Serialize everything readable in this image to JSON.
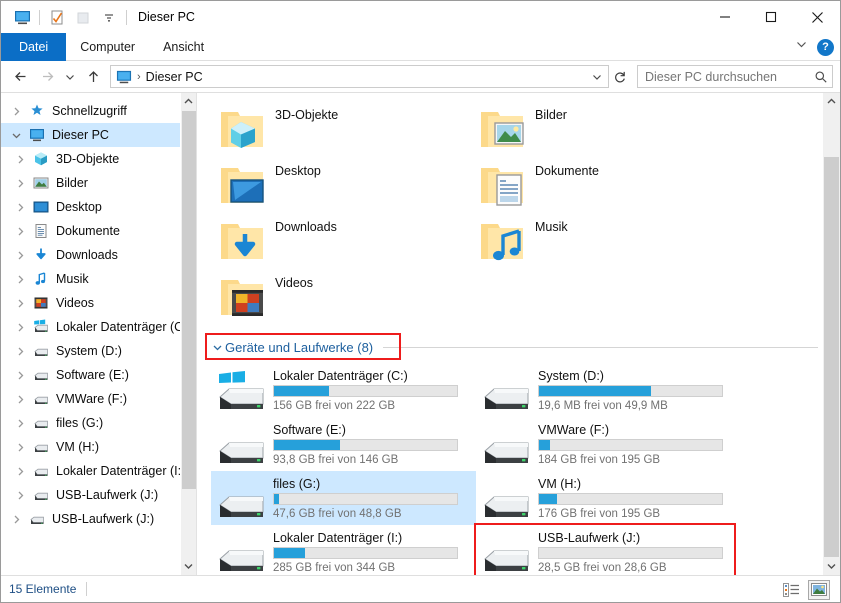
{
  "window": {
    "title": "Dieser PC",
    "quick_access": [
      "this-pc-icon",
      "properties-icon",
      "new-folder-icon",
      "customize-dropdown-icon"
    ],
    "controls": {
      "minimize": "—",
      "maximize": "□",
      "close": "✕"
    }
  },
  "ribbon": {
    "tabs": [
      {
        "label": "Datei",
        "active": true
      },
      {
        "label": "Computer",
        "active": false
      },
      {
        "label": "Ansicht",
        "active": false
      }
    ],
    "collapse_icon": "chevron-down-icon",
    "help_label": "?"
  },
  "address_bar": {
    "back_icon": "arrow-left-icon",
    "forward_icon": "arrow-right-icon",
    "recent_icon": "chevron-down-icon",
    "up_icon": "arrow-up-icon",
    "crumb_icon": "this-pc-icon",
    "crumbs": [
      "Dieser PC"
    ],
    "separator": "›",
    "dropdown_icon": "chevron-down-icon",
    "refresh_icon": "refresh-icon"
  },
  "search": {
    "placeholder": "Dieser PC durchsuchen",
    "icon": "search-icon"
  },
  "sidebar": {
    "items": [
      {
        "label": "Schnellzugriff",
        "icon": "star-pin-icon",
        "level": 0,
        "expanded": false,
        "selected": false
      },
      {
        "label": "Dieser PC",
        "icon": "this-pc-icon",
        "level": 0,
        "expanded": true,
        "selected": true
      },
      {
        "label": "3D-Objekte",
        "icon": "3d-objects-icon",
        "level": 1,
        "expanded": false,
        "selected": false
      },
      {
        "label": "Bilder",
        "icon": "pictures-icon",
        "level": 1,
        "expanded": false,
        "selected": false
      },
      {
        "label": "Desktop",
        "icon": "desktop-icon",
        "level": 1,
        "expanded": false,
        "selected": false
      },
      {
        "label": "Dokumente",
        "icon": "documents-icon",
        "level": 1,
        "expanded": false,
        "selected": false
      },
      {
        "label": "Downloads",
        "icon": "downloads-icon",
        "level": 1,
        "expanded": false,
        "selected": false
      },
      {
        "label": "Musik",
        "icon": "music-icon",
        "level": 1,
        "expanded": false,
        "selected": false
      },
      {
        "label": "Videos",
        "icon": "videos-icon",
        "level": 1,
        "expanded": false,
        "selected": false
      },
      {
        "label": "Lokaler Datenträger (C:)",
        "icon": "windows-drive-icon",
        "level": 1,
        "expanded": false,
        "selected": false
      },
      {
        "label": "System (D:)",
        "icon": "drive-icon",
        "level": 1,
        "expanded": false,
        "selected": false
      },
      {
        "label": "Software (E:)",
        "icon": "drive-icon",
        "level": 1,
        "expanded": false,
        "selected": false
      },
      {
        "label": "VMWare (F:)",
        "icon": "drive-icon",
        "level": 1,
        "expanded": false,
        "selected": false
      },
      {
        "label": "files (G:)",
        "icon": "drive-icon",
        "level": 1,
        "expanded": false,
        "selected": false
      },
      {
        "label": "VM (H:)",
        "icon": "drive-icon",
        "level": 1,
        "expanded": false,
        "selected": false
      },
      {
        "label": "Lokaler Datenträger (I:)",
        "icon": "drive-icon",
        "level": 1,
        "expanded": false,
        "selected": false
      },
      {
        "label": "USB-Laufwerk (J:)",
        "icon": "drive-icon",
        "level": 1,
        "expanded": false,
        "selected": false
      },
      {
        "label": "USB-Laufwerk (J:)",
        "icon": "drive-icon",
        "level": 0,
        "expanded": false,
        "selected": false
      }
    ]
  },
  "content": {
    "folders": [
      {
        "label": "3D-Objekte",
        "icon": "folder-3d-objects-icon"
      },
      {
        "label": "Bilder",
        "icon": "folder-pictures-icon"
      },
      {
        "label": "Desktop",
        "icon": "folder-desktop-icon"
      },
      {
        "label": "Dokumente",
        "icon": "folder-documents-icon"
      },
      {
        "label": "Downloads",
        "icon": "folder-downloads-icon"
      },
      {
        "label": "Musik",
        "icon": "folder-music-icon"
      },
      {
        "label": "Videos",
        "icon": "folder-videos-icon"
      }
    ],
    "group": {
      "title": "Geräte und Laufwerke (8)",
      "chevron": "chevron-down-icon",
      "highlighted": true
    },
    "drives": [
      {
        "name": "Lokaler Datenträger (C:)",
        "free_text": "156 GB frei von 222 GB",
        "used_percent": 30,
        "icon": "windows-drive-icon",
        "selected": false,
        "highlighted": false
      },
      {
        "name": "System (D:)",
        "free_text": "19,6 MB frei von 49,9 MB",
        "used_percent": 61,
        "icon": "drive-icon",
        "selected": false,
        "highlighted": false
      },
      {
        "name": "Software (E:)",
        "free_text": "93,8 GB frei von 146 GB",
        "used_percent": 36,
        "icon": "drive-icon",
        "selected": false,
        "highlighted": false
      },
      {
        "name": "VMWare (F:)",
        "free_text": "184 GB frei von 195 GB",
        "used_percent": 6,
        "icon": "drive-icon",
        "selected": false,
        "highlighted": false
      },
      {
        "name": "files (G:)",
        "free_text": "47,6 GB frei von 48,8 GB",
        "used_percent": 3,
        "icon": "drive-icon",
        "selected": true,
        "highlighted": false
      },
      {
        "name": "VM (H:)",
        "free_text": "176 GB frei von 195 GB",
        "used_percent": 10,
        "icon": "drive-icon",
        "selected": false,
        "highlighted": false
      },
      {
        "name": "Lokaler Datenträger (I:)",
        "free_text": "285 GB frei von 344 GB",
        "used_percent": 17,
        "icon": "drive-icon",
        "selected": false,
        "highlighted": false
      },
      {
        "name": "USB-Laufwerk (J:)",
        "free_text": "28,5 GB frei von 28,6 GB",
        "used_percent": 0,
        "icon": "drive-icon",
        "selected": false,
        "highlighted": true
      }
    ]
  },
  "status_bar": {
    "item_count": "15 Elemente",
    "views": [
      {
        "name": "details-view-icon",
        "active": false
      },
      {
        "name": "large-icons-view-icon",
        "active": true
      }
    ]
  },
  "colors": {
    "accent": "#0b6ec6",
    "highlight_box": "#ee1c1c",
    "selection": "#cde8ff",
    "bar_fill": "#26a0da",
    "group_title": "#1d5f9e",
    "status_text": "#1e4f85"
  }
}
